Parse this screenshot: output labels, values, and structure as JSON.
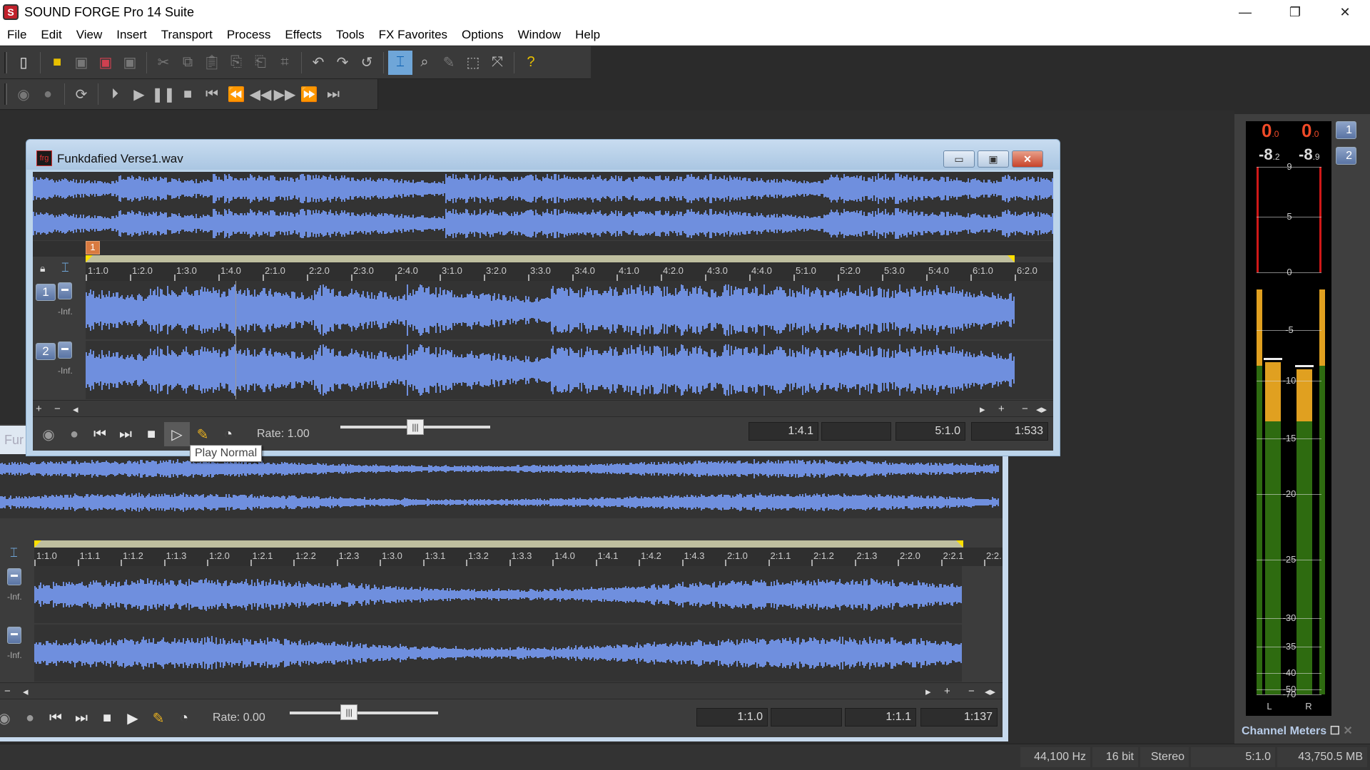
{
  "app": {
    "title": "SOUND FORGE Pro 14 Suite",
    "logo_letter": "S"
  },
  "window_controls": {
    "minimize": "—",
    "restore": "❐",
    "close": "✕"
  },
  "menu": [
    "File",
    "Edit",
    "View",
    "Insert",
    "Transport",
    "Process",
    "Effects",
    "Tools",
    "FX Favorites",
    "Options",
    "Window",
    "Help"
  ],
  "toolbar_main": [
    "new-file",
    "open-folder",
    "save",
    "save-as",
    "save-all",
    "cut",
    "copy",
    "paste",
    "paste-special",
    "mix",
    "crop",
    "undo",
    "redo",
    "repeat",
    "edit-tool",
    "magnify-tool",
    "pencil-tool",
    "event-tool",
    "envelope-tool",
    "help"
  ],
  "toolbar_transport": [
    "record",
    "loop-record",
    "loop",
    "play-all",
    "play",
    "pause",
    "stop",
    "go-to-start",
    "previous",
    "rewind",
    "fast-forward",
    "next",
    "go-to-end"
  ],
  "front_window": {
    "title": "Funkdafied Verse1.wav",
    "icon_text": "frg",
    "marker_label": "1",
    "ruler": [
      "1:1.0",
      "1:2.0",
      "1:3.0",
      "1:4.0",
      "2:1.0",
      "2:2.0",
      "2:3.0",
      "2:4.0",
      "3:1.0",
      "3:2.0",
      "3:3.0",
      "3:4.0",
      "4:1.0",
      "4:2.0",
      "4:3.0",
      "4:4.0",
      "5:1.0",
      "5:2.0",
      "5:3.0",
      "5:4.0",
      "6:1.0",
      "6:2.0"
    ],
    "channels": [
      {
        "num": "1",
        "level": "-Inf."
      },
      {
        "num": "2",
        "level": "-Inf."
      }
    ],
    "rate_label": "Rate: 1.00",
    "rate_value": 1.0,
    "positions": {
      "cursor": "1:4.1",
      "selection": "",
      "end": "5:1.0",
      "zoom": "1:533"
    },
    "tooltip": "Play Normal"
  },
  "back_window": {
    "tab_text": "Fur",
    "ruler": [
      "1:1.0",
      "1:1.1",
      "1:1.2",
      "1:1.3",
      "1:2.0",
      "1:2.1",
      "1:2.2",
      "1:2.3",
      "1:3.0",
      "1:3.1",
      "1:3.2",
      "1:3.3",
      "1:4.0",
      "1:4.1",
      "1:4.2",
      "1:4.3",
      "2:1.0",
      "2:1.1",
      "2:1.2",
      "2:1.3",
      "2:2.0",
      "2:2.1",
      "2:2."
    ],
    "channels": [
      {
        "level": "-Inf."
      },
      {
        "level": "-Inf."
      }
    ],
    "rate_label": "Rate: 0.00",
    "rate_value": 0.0,
    "positions": {
      "cursor": "1:1.0",
      "selection": "",
      "end": "1:1.1",
      "zoom": "1:137"
    }
  },
  "scroll_controls": {
    "plus": "+",
    "minus": "−",
    "left": "◂",
    "right": "▸",
    "fit": "◂▸"
  },
  "meters": {
    "title": "Channel Meters",
    "peak_left": "0",
    "peak_left_dec": ".0",
    "peak_right": "0",
    "peak_right_dec": ".0",
    "rms_left": "-8",
    "rms_left_dec": ".2",
    "rms_right": "-8",
    "rms_right_dec": ".9",
    "scale": [
      "9",
      "5",
      "0",
      "-5",
      "-10",
      "-15",
      "-20",
      "-25",
      "-30",
      "-35",
      "-40",
      "-50",
      "-70"
    ],
    "channel_labels": [
      "L",
      "R"
    ],
    "buttons": [
      "1",
      "2"
    ],
    "level_left_db": -8.2,
    "level_right_db": -8.9
  },
  "status": {
    "sample_rate": "44,100 Hz",
    "bit_depth": "16 bit",
    "channels": "Stereo",
    "length": "5:1.0",
    "disk_space": "43,750.5 MB"
  },
  "colors": {
    "waveform": "#6f8fde",
    "peak_red": "#f04a28",
    "meter_green": "#2e6b10",
    "meter_yellow": "#e0a020",
    "marker_orange": "#d87a40"
  }
}
